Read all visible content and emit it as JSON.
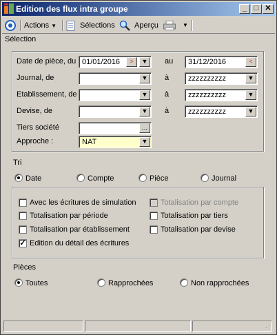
{
  "window": {
    "title": "Edition des flux intra groupe"
  },
  "toolbar": {
    "actions": "Actions",
    "selections": "Sélections",
    "apercu": "Aperçu"
  },
  "selection": {
    "label": "Sélection",
    "date_label": "Date de pièce, du",
    "date_from": "01/01/2016",
    "date_to_label": "au",
    "date_to": "31/12/2016",
    "journal_label": "Journal, de",
    "journal_a": "à",
    "journal_to": "zzzzzzzzzz",
    "etab_label": "Etablissement, de",
    "etab_a": "à",
    "etab_to": "zzzzzzzzzz",
    "devise_label": "Devise, de",
    "devise_a": "à",
    "devise_to": "zzzzzzzzzz",
    "tiers_label": "Tiers société",
    "approche_label": "Approche :",
    "approche_value": "NAT"
  },
  "tri": {
    "label": "Tri",
    "options": [
      "Date",
      "Compte",
      "Pièce",
      "Journal"
    ]
  },
  "options": {
    "simulation": "Avec les écritures de simulation",
    "tot_compte": "Totalisation par compte",
    "tot_periode": "Totalisation par période",
    "tot_tiers": "Totalisation par tiers",
    "tot_etab": "Totalisation par établissement",
    "tot_devise": "Totalisation par devise",
    "detail": "Edition du détail des écritures"
  },
  "pieces": {
    "label": "Pièces",
    "options": [
      "Toutes",
      "Rapprochées",
      "Non rapprochées"
    ]
  }
}
